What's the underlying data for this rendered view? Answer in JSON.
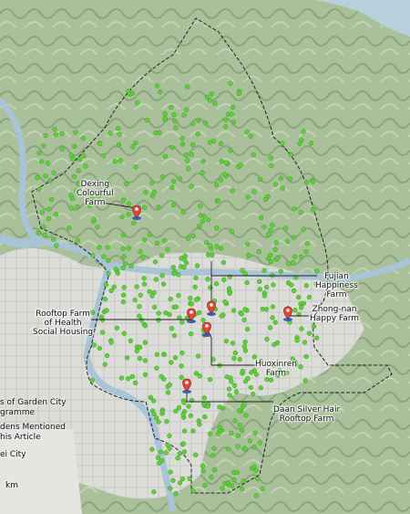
{
  "farms": [
    {
      "id": "dexing",
      "label_lines": [
        "Dexing",
        "Colourful",
        "Farm"
      ]
    },
    {
      "id": "fujian",
      "label_lines": [
        "Fujian",
        "Happiness",
        "Farm"
      ]
    },
    {
      "id": "rooftop-health",
      "label_lines": [
        "Rooftop Farm",
        "of Health",
        "Social Housing"
      ]
    },
    {
      "id": "zhongnan",
      "label_lines": [
        "Zhong-nan",
        "Happy Farm"
      ]
    },
    {
      "id": "huoxinren",
      "label_lines": [
        "Huoxinren",
        "Farm"
      ]
    },
    {
      "id": "daan",
      "label_lines": [
        "Daan Silver Hair",
        "Rooftop Farm"
      ]
    }
  ],
  "legend": {
    "line1": "s of Garden City",
    "line2": "gramme",
    "line3": "dens Mentioned",
    "line4": "his Article",
    "line5": "ei City",
    "line6": "km"
  },
  "colors": {
    "garden_dot": "#5fcf3a",
    "farm_marker": "#e0453a",
    "farm_marker_base": "#3a5fb0",
    "boundary": "#222222",
    "river": "#a8c4d6",
    "urban": "#d9d9d9",
    "mountain": "#9fb88f"
  }
}
